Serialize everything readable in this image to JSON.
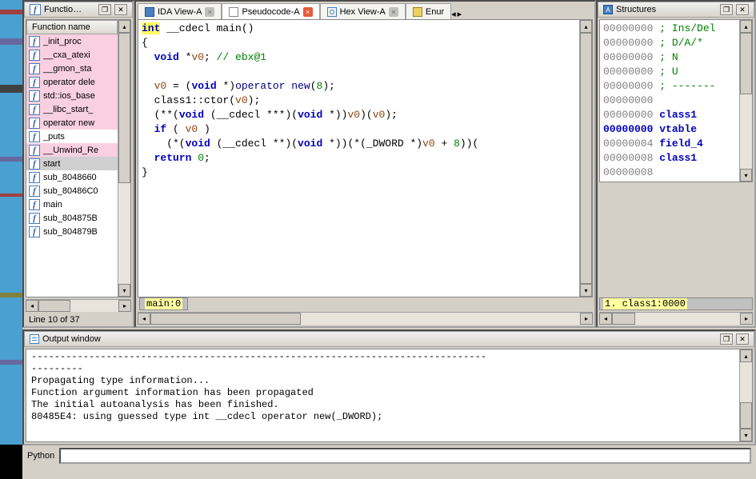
{
  "functions_panel": {
    "title": "Functio…",
    "header": "Function name",
    "items": [
      {
        "name": "_init_proc",
        "pink": true
      },
      {
        "name": "__cxa_atexi",
        "pink": true
      },
      {
        "name": "__gmon_sta",
        "pink": true
      },
      {
        "name": "operator dele",
        "pink": true
      },
      {
        "name": "std::ios_base",
        "pink": true
      },
      {
        "name": "__libc_start_",
        "pink": true
      },
      {
        "name": "operator new",
        "pink": true
      },
      {
        "name": "_puts",
        "pink": false
      },
      {
        "name": "__Unwind_Re",
        "pink": true
      },
      {
        "name": "start",
        "pink": false,
        "hl": true
      },
      {
        "name": "sub_8048660",
        "pink": false
      },
      {
        "name": "sub_80486C0",
        "pink": false
      },
      {
        "name": "main",
        "pink": false
      },
      {
        "name": "sub_804875B",
        "pink": false
      },
      {
        "name": "sub_804879B",
        "pink": false
      }
    ],
    "status": "Line 10 of 37"
  },
  "tabs": [
    {
      "label": "IDA View-A",
      "icon": "ida"
    },
    {
      "label": "Pseudocode-A",
      "icon": "pc",
      "active": true
    },
    {
      "label": "Hex View-A",
      "icon": "hex"
    },
    {
      "label": "Enur",
      "icon": "enum"
    }
  ],
  "code_status": "main:0",
  "structures_panel": {
    "title": "Structures",
    "status": "1.  class1:0000"
  },
  "output_panel": {
    "title": "Output window",
    "lines": [
      "-------------------------------------------------------------------------------",
      "---------",
      "Propagating type information...",
      "Function argument information has been propagated",
      "The initial autoanalysis has been finished.",
      "80485E4: using guessed type int __cdecl operator new(_DWORD);"
    ]
  },
  "python_label": "Python",
  "python_value": ""
}
